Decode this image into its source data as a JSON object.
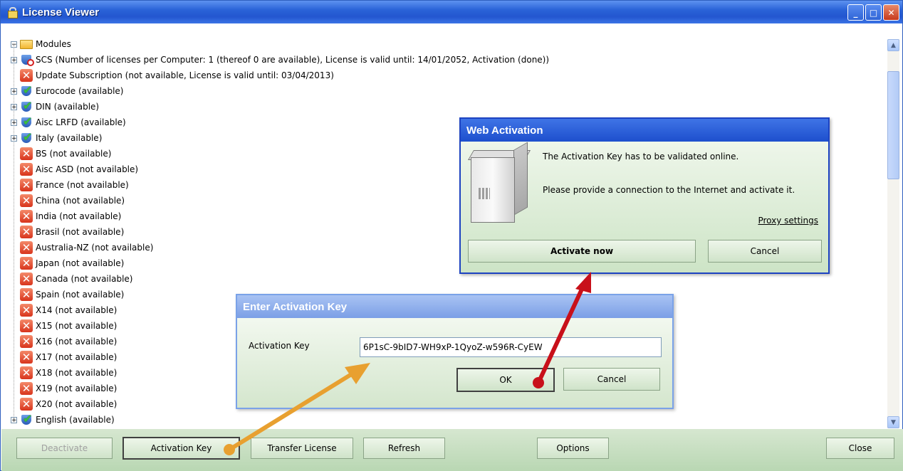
{
  "window": {
    "title": "License Viewer",
    "colors": {
      "titlebar": "#2a63d8",
      "bottombar": "#c8dfc2"
    }
  },
  "tree": {
    "root_label": "Modules",
    "items": [
      {
        "label": "SCS (Number of licenses per Computer: 1 (thereof 0 are available), License is valid until: 14/01/2052, Activation (done))",
        "status": "blocked",
        "expandable": true
      },
      {
        "label": "Update Subscription (not available, License is valid until: 03/04/2013)",
        "status": "unavailable",
        "expandable": false
      },
      {
        "label": "Eurocode (available)",
        "status": "available",
        "expandable": true
      },
      {
        "label": "DIN (available)",
        "status": "available",
        "expandable": true
      },
      {
        "label": "Aisc LRFD (available)",
        "status": "available",
        "expandable": true
      },
      {
        "label": "Italy (available)",
        "status": "available",
        "expandable": true
      },
      {
        "label": "BS (not available)",
        "status": "unavailable",
        "expandable": false
      },
      {
        "label": "Aisc ASD (not available)",
        "status": "unavailable",
        "expandable": false
      },
      {
        "label": "France (not available)",
        "status": "unavailable",
        "expandable": false
      },
      {
        "label": "China (not available)",
        "status": "unavailable",
        "expandable": false
      },
      {
        "label": "India (not available)",
        "status": "unavailable",
        "expandable": false
      },
      {
        "label": "Brasil (not available)",
        "status": "unavailable",
        "expandable": false
      },
      {
        "label": "Australia-NZ (not available)",
        "status": "unavailable",
        "expandable": false
      },
      {
        "label": "Japan (not available)",
        "status": "unavailable",
        "expandable": false
      },
      {
        "label": "Canada (not available)",
        "status": "unavailable",
        "expandable": false
      },
      {
        "label": "Spain (not available)",
        "status": "unavailable",
        "expandable": false
      },
      {
        "label": "X14 (not available)",
        "status": "unavailable",
        "expandable": false
      },
      {
        "label": "X15 (not available)",
        "status": "unavailable",
        "expandable": false
      },
      {
        "label": "X16 (not available)",
        "status": "unavailable",
        "expandable": false
      },
      {
        "label": "X17 (not available)",
        "status": "unavailable",
        "expandable": false
      },
      {
        "label": "X18 (not available)",
        "status": "unavailable",
        "expandable": false
      },
      {
        "label": "X19 (not available)",
        "status": "unavailable",
        "expandable": false
      },
      {
        "label": "X20 (not available)",
        "status": "unavailable",
        "expandable": false
      },
      {
        "label": "English (available)",
        "status": "available",
        "expandable": true
      }
    ]
  },
  "bottom_buttons": {
    "deactivate": "Deactivate",
    "activation_key": "Activation Key",
    "transfer_license": "Transfer License",
    "refresh": "Refresh",
    "options": "Options",
    "close": "Close"
  },
  "web_activation": {
    "title": "Web Activation",
    "message1": "The Activation Key has to be validated online.",
    "message2": "Please provide a connection to the Internet and activate it.",
    "proxy_settings": "Proxy settings",
    "activate_now": "Activate now",
    "cancel": "Cancel"
  },
  "enter_key": {
    "title": "Enter Activation Key",
    "label": "Activation Key",
    "value": "6P1sC-9bID7-WH9xP-1QyoZ-w596R-CyEW",
    "ok": "OK",
    "cancel": "Cancel"
  },
  "annotation_colors": {
    "orange_arrow": "#e8a030",
    "red_arrow": "#c8101a"
  }
}
